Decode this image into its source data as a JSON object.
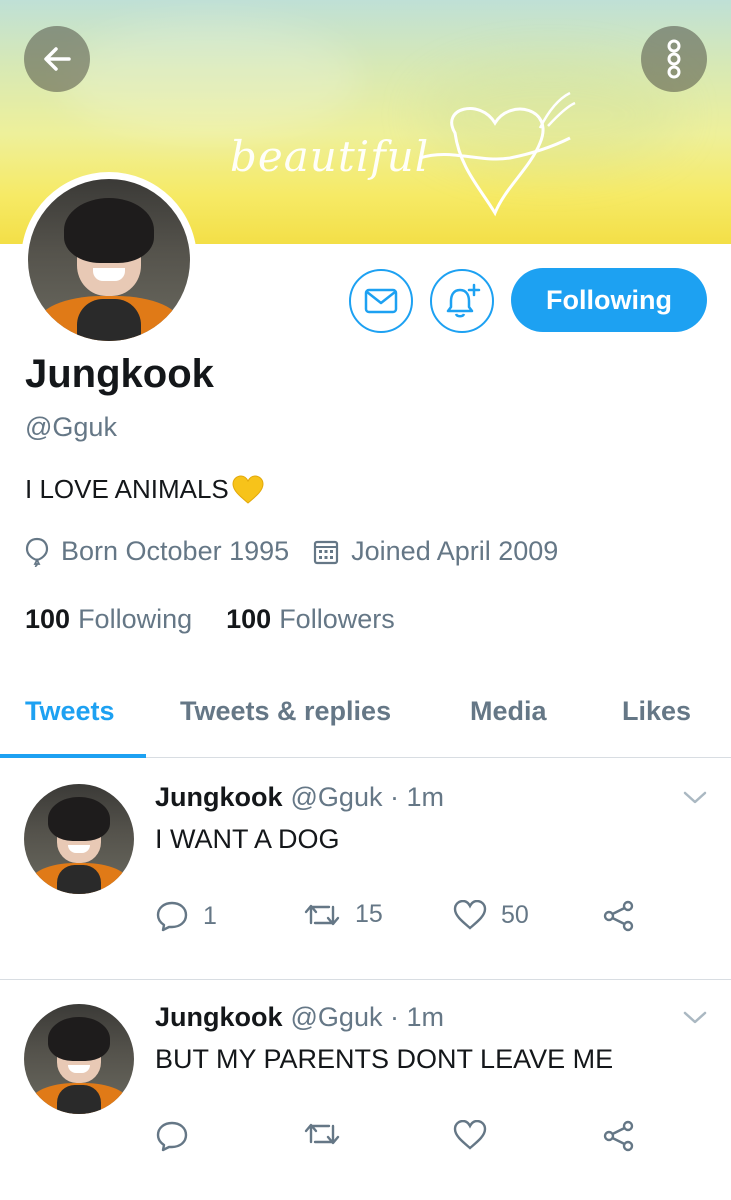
{
  "banner": {
    "text": "beautiful"
  },
  "actions": {
    "following_label": "Following"
  },
  "profile": {
    "name": "Jungkook",
    "handle": "@Gguk",
    "bio": "I LOVE ANIMALS",
    "born": "Born October 1995",
    "joined": "Joined April 2009",
    "following_count": "100",
    "following_label": "Following",
    "followers_count": "100",
    "followers_label": "Followers"
  },
  "tabs": [
    {
      "label": "Tweets",
      "active": true
    },
    {
      "label": "Tweets & replies",
      "active": false
    },
    {
      "label": "Media",
      "active": false
    },
    {
      "label": "Likes",
      "active": false
    }
  ],
  "tweets": [
    {
      "name": "Jungkook",
      "handle": "@Gguk",
      "time": "· 1m",
      "text": "I WANT A DOG",
      "replies": "1",
      "retweets": "15",
      "likes": "50"
    },
    {
      "name": "Jungkook",
      "handle": "@Gguk",
      "time": "· 1m",
      "text": "BUT MY PARENTS DONT LEAVE ME",
      "replies": "",
      "retweets": "",
      "likes": ""
    }
  ],
  "colors": {
    "accent": "#1da1f2",
    "muted": "#657786",
    "text": "#14171a"
  }
}
